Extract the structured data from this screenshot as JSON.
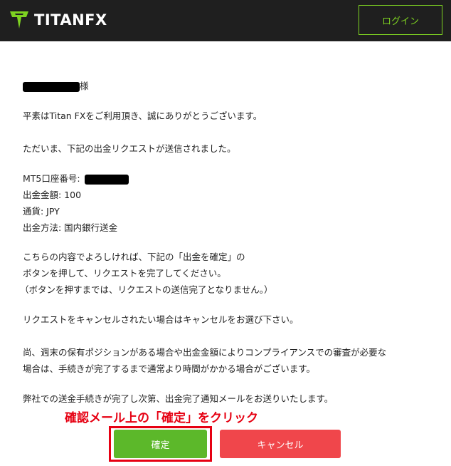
{
  "header": {
    "logo_text": "TITANFX",
    "login_label": "ログイン"
  },
  "email": {
    "salutation_suffix": "様",
    "greeting": "平素はTitan FXをご利用頂き、誠にありがとうございます。",
    "intro": "ただいま、下記の出金リクエストが送信されました。",
    "details": {
      "account_label": "MT5口座番号:",
      "amount": "出金金額: 100",
      "currency": "通貨: JPY",
      "method": "出金方法: 国内銀行送金"
    },
    "instruction_1": "こちらの内容でよろしければ、下記の「出金を確定」の",
    "instruction_2": "ボタンを押して、リクエストを完了してください。",
    "instruction_3": "（ボタンを押すまでは、リクエストの送信完了となりません。）",
    "cancel_note": "リクエストをキャンセルされたい場合はキャンセルをお選び下さい。",
    "review_note_1": "尚、週末の保有ポジションがある場合や出金金額によりコンプライアンスでの審査が必要な",
    "review_note_2": "場合は、手続きが完了するまで通常より時間がかかる場合がございます。",
    "completion_note": "弊社での送金手続きが完了し次第、出金完了通知メールをお送りいたします。"
  },
  "annotation": "確認メール上の「確定」をクリック",
  "buttons": {
    "confirm_label": "確定",
    "cancel_label": "キャンセル"
  },
  "colors": {
    "header_bg": "#1f1f1f",
    "brand_green": "#7ed321",
    "confirm_green": "#5cb82a",
    "cancel_red": "#f0464b",
    "annotation_red": "#e60012"
  }
}
